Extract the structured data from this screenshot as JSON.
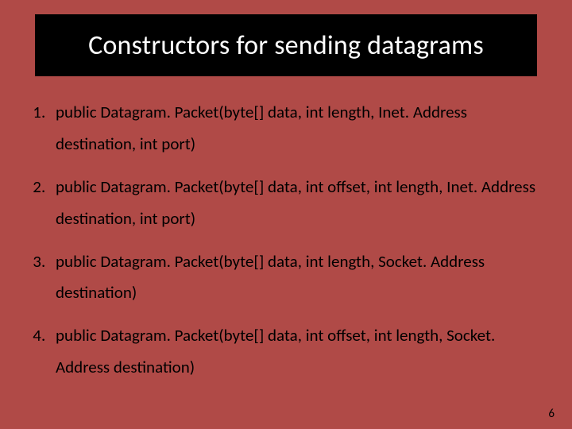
{
  "title": "Constructors for sending datagrams",
  "items": [
    "public Datagram. Packet(byte[] data, int length, Inet. Address destination, int port)",
    "public Datagram. Packet(byte[] data, int offset, int length, Inet. Address destination, int port)",
    "public Datagram. Packet(byte[] data, int length, Socket. Address destination)",
    "public Datagram. Packet(byte[] data, int offset, int length, Socket. Address destination)"
  ],
  "slide_number": "6"
}
